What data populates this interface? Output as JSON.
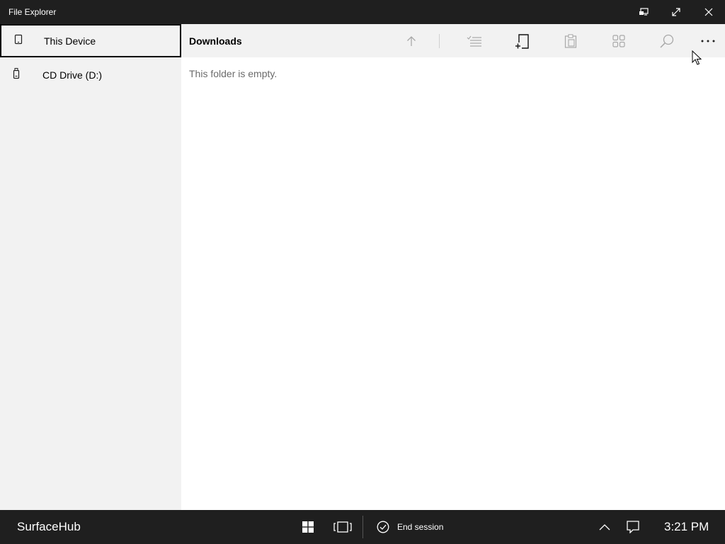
{
  "window": {
    "title": "File Explorer",
    "controls": [
      "display-switch-icon",
      "maximize-icon",
      "close-icon"
    ]
  },
  "sidebar": {
    "items": [
      {
        "label": "This Device",
        "icon": "device-icon",
        "selected": true
      },
      {
        "label": "CD Drive (D:)",
        "icon": "drive-icon",
        "selected": false
      }
    ]
  },
  "toolbar": {
    "folder_title": "Downloads",
    "tools": [
      "up-arrow-icon",
      "select-list-icon",
      "new-folder-icon",
      "paste-icon",
      "view-grid-icon",
      "search-icon",
      "more-icon"
    ]
  },
  "content": {
    "empty_message": "This folder is empty."
  },
  "taskbar": {
    "hub_name": "SurfaceHub",
    "end_session_label": "End session",
    "clock": "3:21 PM",
    "icons": [
      "windows-start-icon",
      "task-view-icon",
      "check-circle-icon",
      "chevron-up-icon",
      "action-center-icon"
    ]
  }
}
